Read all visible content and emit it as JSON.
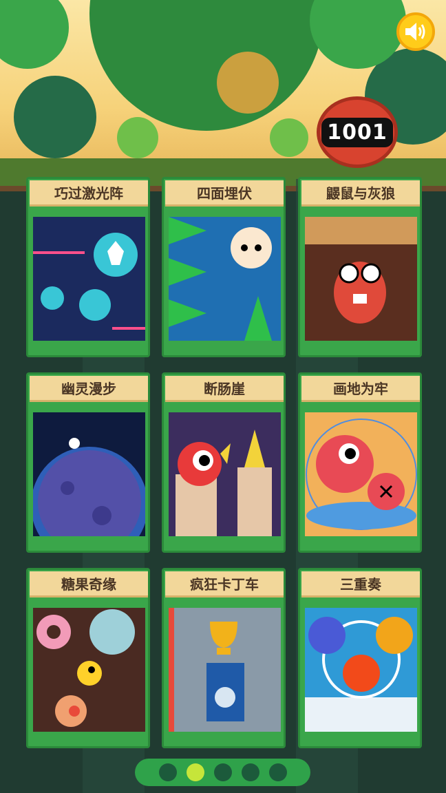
{
  "header": {
    "sound_icon": "speaker-icon",
    "logo_text": "1001"
  },
  "games": [
    {
      "label": "巧过激光阵",
      "thumb": "laser-dodge"
    },
    {
      "label": "四面埋伏",
      "thumb": "crocodile-ambush"
    },
    {
      "label": "鼹鼠与灰狼",
      "thumb": "mole-and-wolf"
    },
    {
      "label": "幽灵漫步",
      "thumb": "ghost-walk"
    },
    {
      "label": "断肠崖",
      "thumb": "cliff"
    },
    {
      "label": "画地为牢",
      "thumb": "draw-prison"
    },
    {
      "label": "糖果奇缘",
      "thumb": "candy"
    },
    {
      "label": "疯狂卡丁车",
      "thumb": "kart"
    },
    {
      "label": "三重奏",
      "thumb": "trio"
    }
  ],
  "pagination": {
    "pages": 5,
    "current": 2
  },
  "colors": {
    "card_green": "#3aa64a",
    "title_bar": "#f2d79a",
    "active_dot": "#c6e53a",
    "inactive_dot": "#1c5a3b"
  }
}
